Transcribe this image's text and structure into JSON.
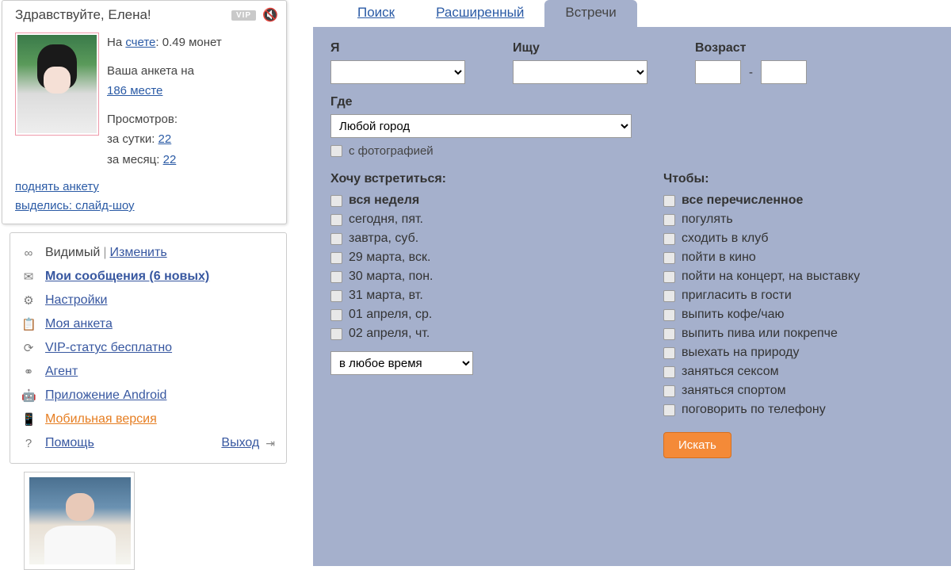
{
  "sidebar": {
    "greeting": "Здравствуйте, Елена!",
    "vip_badge": "VIP",
    "balance_prefix": "На ",
    "balance_link": "счете",
    "balance_suffix": ": 0.49 монет",
    "rank_prefix": "Ваша анкета на",
    "rank_link": "186 месте",
    "views_label": "Просмотров:",
    "views_day_label": "за сутки:",
    "views_day_link": "22",
    "views_month_label": "за месяц:",
    "views_month_link": "22",
    "link_raise": "поднять анкету",
    "link_slideshow": "выделись: слайд-шоу"
  },
  "menu": {
    "visibility_icon": "∞",
    "visibility_label": "Видимый",
    "visibility_change": "Изменить",
    "messages_icon": "✉",
    "messages_label": "Мои сообщения (6 новых)",
    "settings_icon": "⚙",
    "settings_label": "Настройки",
    "profile_icon": "📋",
    "profile_label": "Моя анкета",
    "vip_icon": "⟳",
    "vip_label": "VIP-статус бесплатно",
    "agent_icon": "⚭",
    "agent_label": "Агент",
    "android_icon": "🤖",
    "android_label": "Приложение Android",
    "mobile_icon": "📱",
    "mobile_label": "Мобильная версия",
    "help_icon": "?",
    "help_label": "Помощь",
    "exit_label": "Выход"
  },
  "tabs": {
    "search": "Поиск",
    "advanced": "Расширенный",
    "meetings": "Встречи"
  },
  "filters": {
    "i_label": "Я",
    "seek_label": "Ищу",
    "age_label": "Возраст",
    "age_sep": "-",
    "where_label": "Где",
    "city_value": "Любой город",
    "photo_label": "с фотографией",
    "meet_title": "Хочу встретиться:",
    "days": [
      "вся неделя",
      "сегодня, пят.",
      "завтра, суб.",
      "29 марта, вск.",
      "30 марта, пон.",
      "31 марта, вт.",
      "01 апреля, ср.",
      "02 апреля, чт."
    ],
    "time_value": "в любое время",
    "purpose_title": "Чтобы:",
    "purposes": [
      "все перечисленное",
      "погулять",
      "сходить в клуб",
      "пойти в кино",
      "пойти на концерт, на выставку",
      "пригласить в гости",
      "выпить кофе/чаю",
      "выпить пива или покрепче",
      "выехать на природу",
      "заняться сексом",
      "заняться спортом",
      "поговорить по телефону"
    ],
    "search_btn": "Искать"
  }
}
